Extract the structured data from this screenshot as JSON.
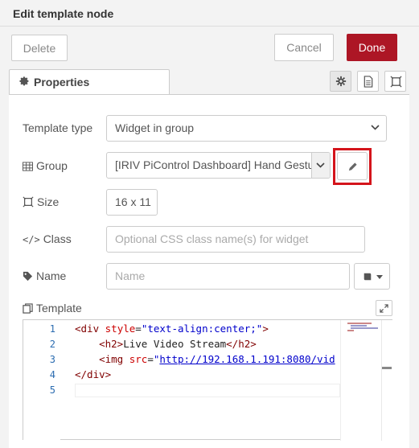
{
  "header": {
    "title": "Edit template node"
  },
  "buttons": {
    "delete": "Delete",
    "cancel": "Cancel",
    "done": "Done"
  },
  "tabs": {
    "properties": "Properties"
  },
  "form": {
    "template_type": {
      "label": "Template type",
      "value": "Widget in group"
    },
    "group": {
      "label": "Group",
      "value": "[IRIV PiControl Dashboard] Hand Gestu"
    },
    "size": {
      "label": "Size",
      "value": "16 x 11"
    },
    "class": {
      "label": "Class",
      "placeholder": "Optional CSS class name(s) for widget"
    },
    "name": {
      "label": "Name",
      "placeholder": "Name"
    },
    "template": {
      "label": "Template"
    }
  },
  "editor": {
    "line_numbers": [
      "1",
      "2",
      "3",
      "4",
      "5"
    ],
    "lines": [
      {
        "open": "<div ",
        "attr": "style",
        "eq": "=",
        "str": "\"text-align:center;\"",
        "close": ">"
      },
      {
        "indent": "    ",
        "open": "<h2>",
        "text": "Live Video Stream",
        "close": "</h2>"
      },
      {
        "indent": "    ",
        "open": "<img ",
        "attr": "src",
        "eq": "=",
        "str_q": "\"",
        "url": "http://192.168.1.191:8080/vid"
      },
      {
        "open": "</div>"
      }
    ]
  },
  "colors": {
    "accent": "#ad1625",
    "highlight": "#d4141b"
  }
}
